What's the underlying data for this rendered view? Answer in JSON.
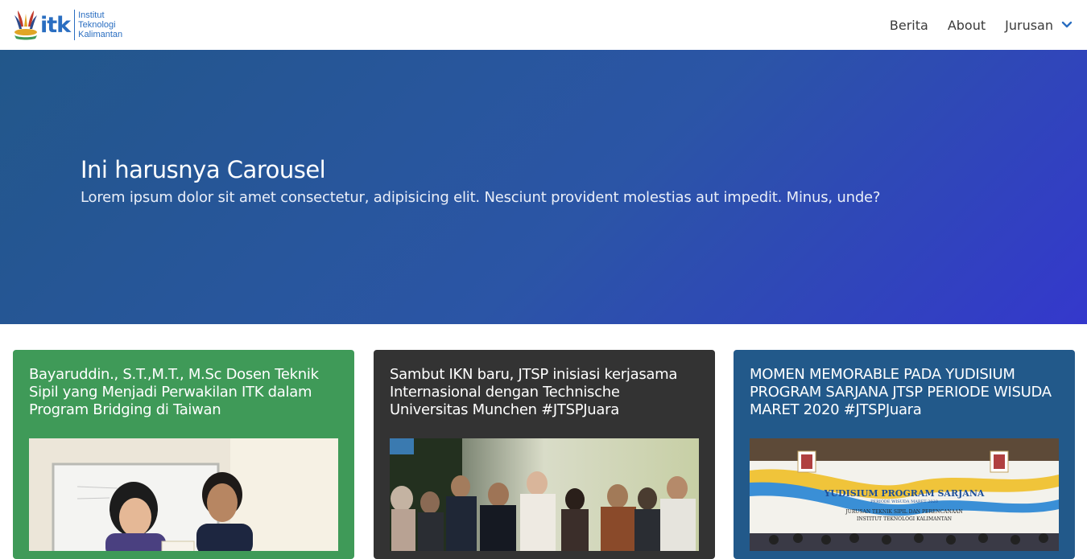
{
  "brand": {
    "logo_text": "itk",
    "line1": "Institut",
    "line2": "Teknologi",
    "line3": "Kalimantan"
  },
  "nav": {
    "items": [
      {
        "label": "Berita"
      },
      {
        "label": "About"
      },
      {
        "label": "Jurusan"
      }
    ]
  },
  "hero": {
    "title": "Ini harusnya Carousel",
    "subtitle": "Lorem ipsum dolor sit amet consectetur, adipisicing elit. Nesciunt provident molestias aut impedit. Minus, unde?"
  },
  "cards": [
    {
      "title": "Bayaruddin., S.T.,M.T., M.Sc Dosen Teknik Sipil yang Menjadi Perwakilan ITK dalam Program Bridging di Taiwan",
      "color": "#3f9a58"
    },
    {
      "title": "Sambut IKN baru, JTSP inisiasi kerjasama Internasional dengan Technische Universitas Munchen #JTSPJuara",
      "color": "#333333"
    },
    {
      "title": "MOMEN MEMORABLE PADA YUDISIUM PROGRAM SARJANA JTSP PERIODE WISUDA MARET 2020 #JTSPJuara",
      "color": "#22598a",
      "banner_title": "YUDISIUM PROGRAM SARJANA",
      "banner_sub": "PERIODE WISUDA MARET 2020",
      "banner_dept1": "JURUSAN TEKNIK SIPIL DAN PERENCANAAN",
      "banner_dept2": "INSTITUT TEKNOLOGI KALIMANTAN"
    }
  ],
  "colors": {
    "brand_blue": "#2a6ec1",
    "hero_start": "#22578a",
    "hero_end": "#3438cc"
  }
}
